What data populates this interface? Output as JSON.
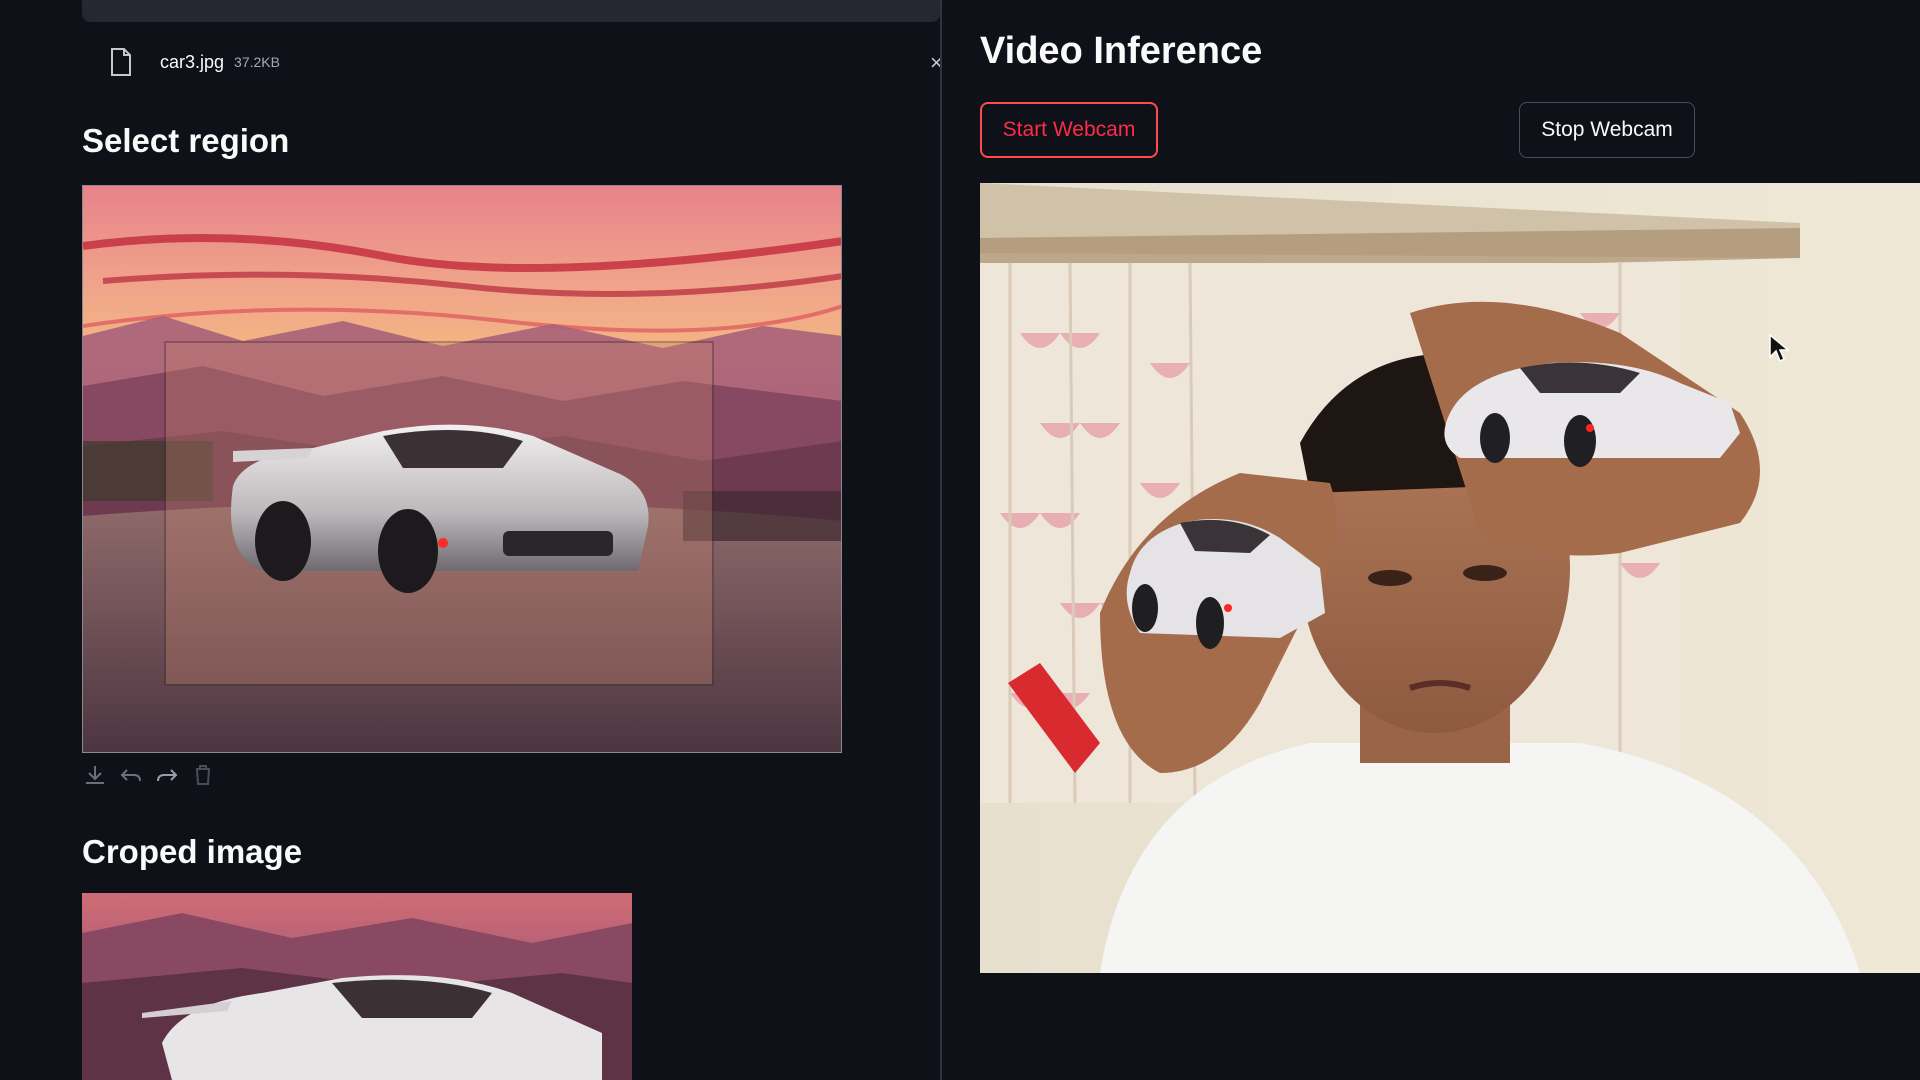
{
  "upload": {
    "file_name": "car3.jpg",
    "file_size": "37.2KB",
    "close_glyph": "×",
    "file_icon": "file-icon"
  },
  "left": {
    "select_region_heading": "Select region",
    "cropped_heading": "Croped image",
    "toolbar_icons": [
      "download-icon",
      "undo-icon",
      "redo-icon",
      "trash-icon"
    ]
  },
  "right": {
    "title": "Video Inference",
    "start_label": "Start Webcam",
    "stop_label": "Stop Webcam"
  },
  "colors": {
    "background": "#0e1117",
    "accent": "#ff4b4b",
    "panel": "#262730"
  }
}
